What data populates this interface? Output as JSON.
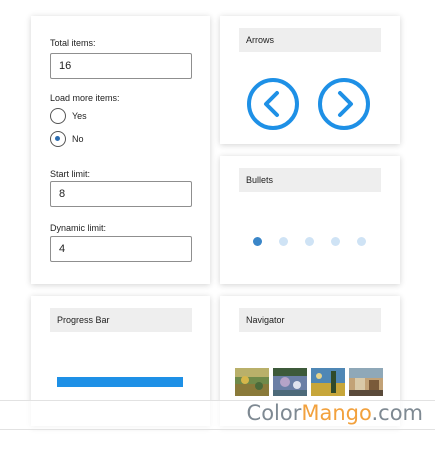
{
  "settings": {
    "total_items": {
      "label": "Total items:",
      "value": "16"
    },
    "load_more": {
      "label": "Load more items:",
      "options": [
        {
          "label": "Yes",
          "checked": false
        },
        {
          "label": "No",
          "checked": true
        }
      ]
    },
    "start_limit": {
      "label": "Start limit:",
      "value": "8"
    },
    "dynamic_limit": {
      "label": "Dynamic limit:",
      "value": "4"
    }
  },
  "arrows": {
    "title": "Arrows",
    "prev_icon": "chevron-left-circle-icon",
    "next_icon": "chevron-right-circle-icon"
  },
  "bullets": {
    "title": "Bullets",
    "count": 5,
    "active_index": 0
  },
  "progress": {
    "title": "Progress Bar",
    "fraction": 1.0
  },
  "navigator": {
    "title": "Navigator",
    "thumbnail_count": 4
  },
  "watermark": {
    "part1": "Color",
    "part2": "Mango",
    "part3": ".com"
  },
  "colors": {
    "accent": "#1e90e6",
    "bullet_active": "#3a86c8",
    "bullet_inactive": "#cfe3f5",
    "header_bg": "#eeeeee"
  }
}
